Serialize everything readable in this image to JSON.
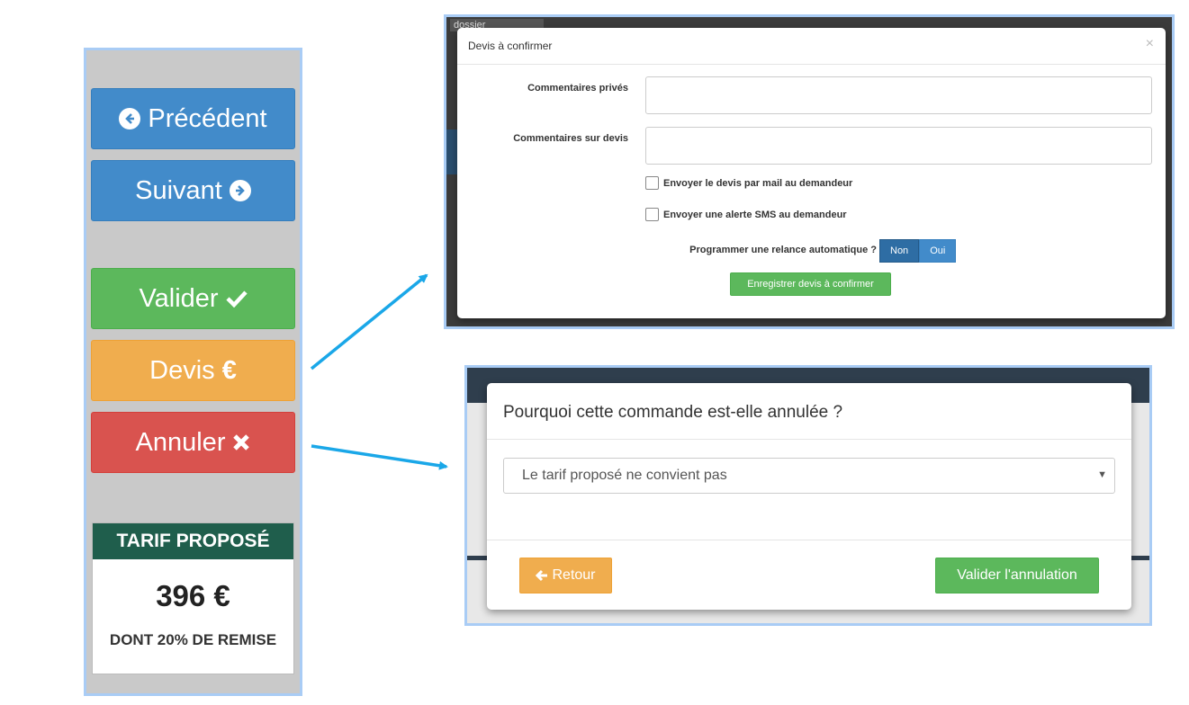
{
  "sidebar": {
    "prev_label": "Précédent",
    "next_label": "Suivant",
    "validate_label": "Valider",
    "devis_label": "Devis",
    "cancel_label": "Annuler",
    "tarif_title": "TARIF PROPOSÉ",
    "tarif_price": "396 €",
    "tarif_discount": "DONT 20% DE REMISE"
  },
  "devis_modal": {
    "bg_search": "dossier",
    "title": "Devis à confirmer",
    "close": "×",
    "private_comments_label": "Commentaires privés",
    "devis_comments_label": "Commentaires sur devis",
    "email_checkbox_label": "Envoyer le devis par mail au demandeur",
    "sms_checkbox_label": "Envoyer une alerte SMS au demandeur",
    "reminder_label": "Programmer une relance automatique ?",
    "toggle_no": "Non",
    "toggle_yes": "Oui",
    "save_label": "Enregistrer devis à confirmer"
  },
  "annul_modal": {
    "title": "Pourquoi cette commande est-elle annulée ?",
    "selected_reason": "Le tarif proposé ne convient pas",
    "back_label": "Retour",
    "confirm_label": "Valider l'annulation"
  },
  "colors": {
    "blue": "#428bca",
    "green": "#5cb85c",
    "orange": "#f0ad4e",
    "red": "#d9534f",
    "tarif_header": "#1f5e4c",
    "arrow": "#1aa7e8",
    "frame_border": "#a9ccf5"
  }
}
